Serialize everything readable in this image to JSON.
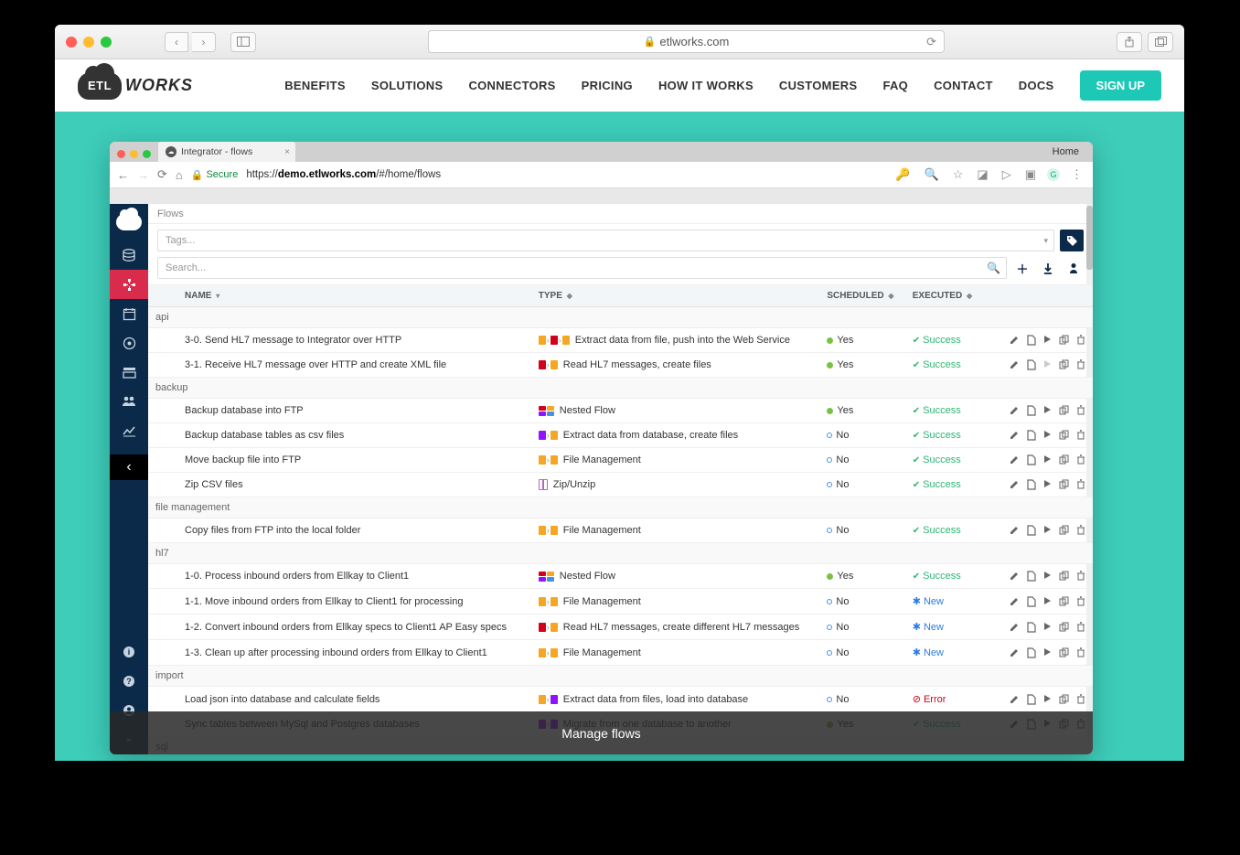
{
  "outer_browser": {
    "domain": "etlworks.com",
    "tabs_plus": "+"
  },
  "site_header": {
    "logo_cloud_text": "ETL",
    "logo_text": "WORKS",
    "nav": [
      "BENEFITS",
      "SOLUTIONS",
      "CONNECTORS",
      "PRICING",
      "HOW IT WORKS",
      "CUSTOMERS",
      "FAQ",
      "CONTACT",
      "DOCS"
    ],
    "signup": "SIGN UP"
  },
  "inner_browser": {
    "tab_title": "Integrator - flows",
    "home_link": "Home",
    "secure_label": "Secure",
    "url_prefix": "https://",
    "url_host": "demo.etlworks.com",
    "url_path": "/#/home/flows"
  },
  "app": {
    "breadcrumb": "Flows",
    "tags_placeholder": "Tags...",
    "search_placeholder": "Search...",
    "columns": {
      "name": "NAME",
      "type": "TYPE",
      "scheduled": "SCHEDULED",
      "executed": "EXECUTED"
    },
    "groups": [
      {
        "label": "api",
        "rows": [
          {
            "name": "3-0. Send HL7 message to Integrator over HTTP",
            "type": "Extract data from file, push into the Web Service",
            "type_icons": [
              "org",
              "red",
              "org"
            ],
            "sched": "Yes",
            "exec": "Success",
            "exec_kind": "success",
            "run_disabled": false
          },
          {
            "name": "3-1. Receive HL7 message over HTTP and create XML file",
            "type": "Read HL7 messages, create files",
            "type_icons": [
              "red",
              "org"
            ],
            "sched": "Yes",
            "exec": "Success",
            "exec_kind": "success",
            "run_disabled": true
          }
        ]
      },
      {
        "label": "backup",
        "rows": [
          {
            "name": "Backup database into FTP",
            "type": "Nested Flow",
            "type_icons": [
              "nested"
            ],
            "sched": "Yes",
            "exec": "Success",
            "exec_kind": "success"
          },
          {
            "name": "Backup database tables as csv files",
            "type": "Extract data from database, create files",
            "type_icons": [
              "pur",
              "org"
            ],
            "sched": "No",
            "exec": "Success",
            "exec_kind": "success"
          },
          {
            "name": "Move backup file into FTP",
            "type": "File Management",
            "type_icons": [
              "org",
              "org"
            ],
            "sched": "No",
            "exec": "Success",
            "exec_kind": "success"
          },
          {
            "name": "Zip CSV files",
            "type": "Zip/Unzip",
            "type_icons": [
              "zip"
            ],
            "sched": "No",
            "exec": "Success",
            "exec_kind": "success"
          }
        ]
      },
      {
        "label": "file management",
        "rows": [
          {
            "name": "Copy files from FTP into the local folder",
            "type": "File Management",
            "type_icons": [
              "org",
              "org"
            ],
            "sched": "No",
            "exec": "Success",
            "exec_kind": "success"
          }
        ]
      },
      {
        "label": "hl7",
        "rows": [
          {
            "name": "1-0. Process inbound orders from Ellkay to Client1",
            "type": "Nested Flow",
            "type_icons": [
              "nested"
            ],
            "sched": "Yes",
            "exec": "Success",
            "exec_kind": "success"
          },
          {
            "name": "1-1. Move inbound orders from Ellkay to Client1 for processing",
            "type": "File Management",
            "type_icons": [
              "org",
              "org"
            ],
            "sched": "No",
            "exec": "New",
            "exec_kind": "new"
          },
          {
            "name": "1-2. Convert inbound orders from Ellkay specs to Client1 AP Easy specs",
            "type": "Read HL7 messages, create different HL7 messages",
            "type_icons": [
              "red",
              "org"
            ],
            "sched": "No",
            "exec": "New",
            "exec_kind": "new"
          },
          {
            "name": "1-3. Clean up after processing inbound orders from Ellkay to Client1",
            "type": "File Management",
            "type_icons": [
              "org",
              "org"
            ],
            "sched": "No",
            "exec": "New",
            "exec_kind": "new"
          }
        ]
      },
      {
        "label": "import",
        "rows": [
          {
            "name": "Load json into database and calculate fields",
            "type": "Extract data from files, load into database",
            "type_icons": [
              "org",
              "pur"
            ],
            "sched": "No",
            "exec": "Error",
            "exec_kind": "error"
          },
          {
            "name": "Sync tables between MySql and Postgres databases",
            "type": "Migrate from one database to another",
            "type_icons": [
              "pur",
              "pur"
            ],
            "sched": "Yes",
            "exec": "Success",
            "exec_kind": "success"
          }
        ]
      },
      {
        "label": "sql",
        "rows": []
      }
    ]
  },
  "caption": "Manage flows"
}
